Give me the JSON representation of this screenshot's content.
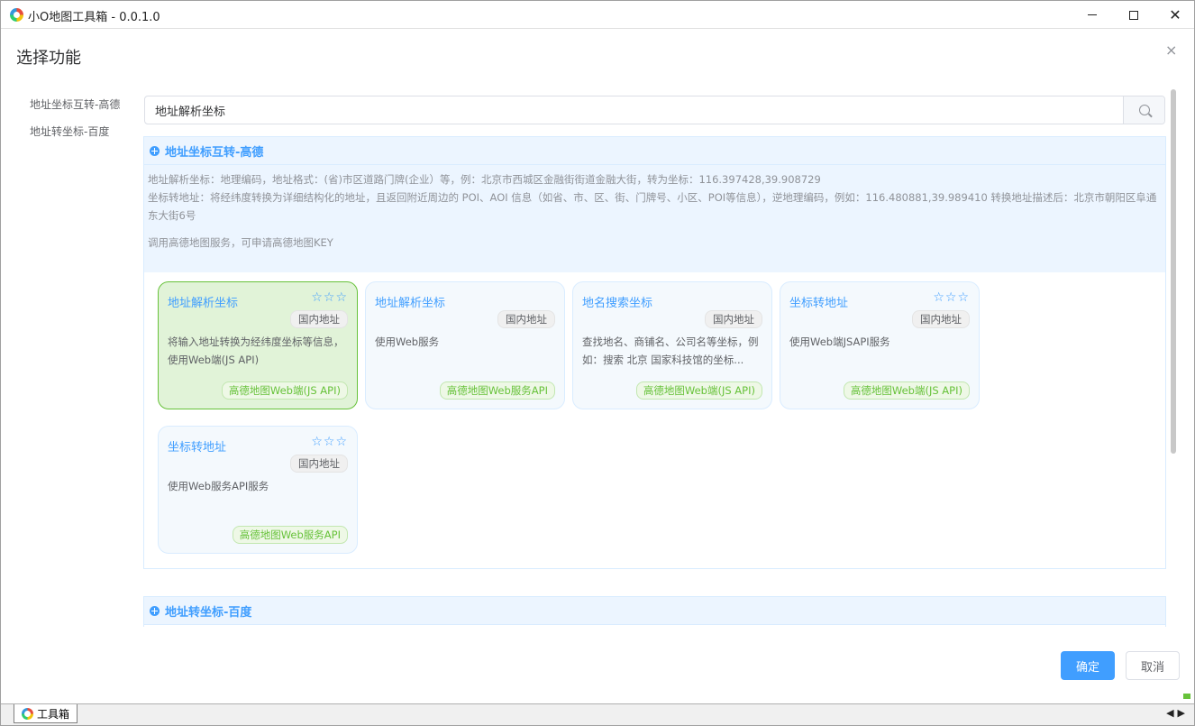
{
  "window": {
    "title": "小O地图工具箱 - 0.0.1.0"
  },
  "dialog": {
    "title": "选择功能",
    "close": "×"
  },
  "sidebar": {
    "items": [
      {
        "label": "地址坐标互转-高德"
      },
      {
        "label": "地址转坐标-百度"
      }
    ]
  },
  "search": {
    "value": "地址解析坐标"
  },
  "groups": [
    {
      "title": "地址坐标互转-高德",
      "desc": [
        "地址解析坐标：地理编码，地址格式：(省)市区道路门牌(企业）等，例：北京市西城区金融街街道金融大街，转为坐标：116.397428,39.908729",
        "坐标转地址：将经纬度转换为详细结构化的地址，且返回附近周边的 POI、AOI 信息（如省、市、区、街、门牌号、小区、POI等信息），逆地理编码，例如：116.480881,39.989410 转换地址描述后：北京市朝阳区阜通东大街6号",
        "调用高德地图服务，可申请高德地图KEY"
      ],
      "cards": [
        {
          "title": "地址解析坐标",
          "stars": "☆☆☆",
          "tag": "国内地址",
          "desc": "将输入地址转换为经纬度坐标等信息，使用Web端(JS API)",
          "api": "高德地图Web端(JS API)"
        },
        {
          "title": "地址解析坐标",
          "stars": "",
          "tag": "国内地址",
          "desc": "使用Web服务",
          "api": "高德地图Web服务API"
        },
        {
          "title": "地名搜索坐标",
          "stars": "",
          "tag": "国内地址",
          "desc": "查找地名、商铺名、公司名等坐标，例如：搜索 北京 国家科技馆的坐标...",
          "api": "高德地图Web端(JS API)"
        },
        {
          "title": "坐标转地址",
          "stars": "☆☆☆",
          "tag": "国内地址",
          "desc": "使用Web端JSAPI服务",
          "api": "高德地图Web端(JS API)"
        },
        {
          "title": "坐标转地址",
          "stars": "☆☆☆",
          "tag": "国内地址",
          "desc": "使用Web服务API服务",
          "api": "高德地图Web服务API"
        }
      ]
    },
    {
      "title": "地址转坐标-百度"
    }
  ],
  "buttons": {
    "ok": "确定",
    "cancel": "取消"
  },
  "statusbar": {
    "tab": "工具箱",
    "arrows": "◀▶"
  }
}
